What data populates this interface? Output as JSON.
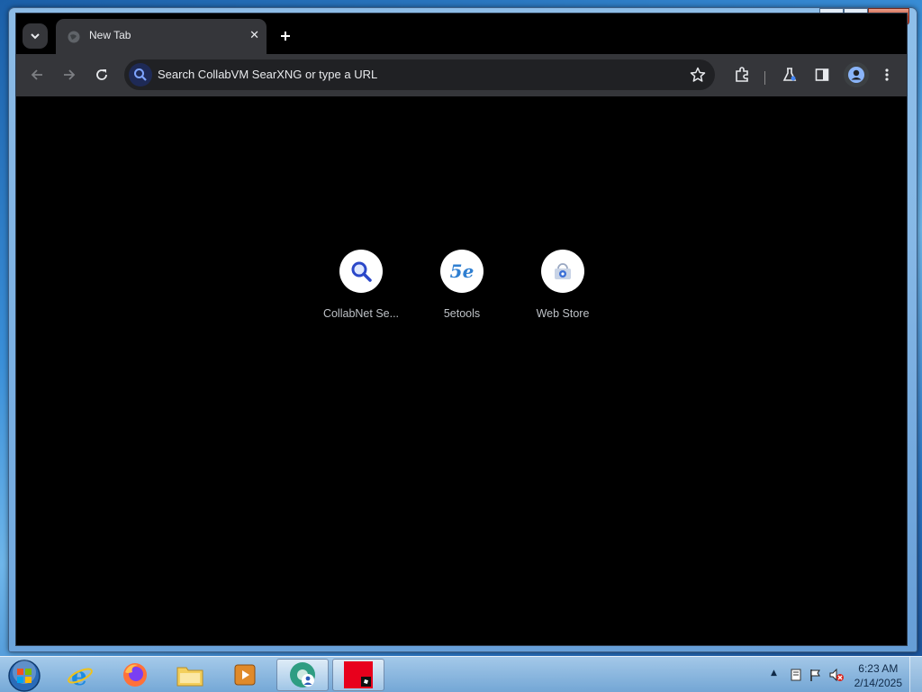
{
  "window": {
    "minimize_glyph": "‒",
    "maximize_glyph": "□",
    "close_glyph": "✕"
  },
  "browser": {
    "tab": {
      "title": "New Tab",
      "close_glyph": "✕"
    },
    "newtab_glyph": "+",
    "omnibox": {
      "placeholder": "Search CollabVM SearXNG or type a URL"
    },
    "toolbar_icons": [
      "back-icon",
      "forward-icon",
      "reload-icon",
      "star-icon",
      "extensions-icon",
      "labs-icon",
      "side-panel-icon",
      "profile-icon",
      "more-icon"
    ]
  },
  "ntp": {
    "shortcuts": [
      {
        "label": "CollabNet Se...",
        "icon": "search-magnifier"
      },
      {
        "label": "5etools",
        "icon": "5etools-logo",
        "glyph": "5e"
      },
      {
        "label": "Web Store",
        "icon": "web-store-logo"
      }
    ]
  },
  "taskbar": {
    "apps": [
      "internet-explorer",
      "firefox",
      "file-explorer",
      "media-player",
      "chrome",
      "roblox"
    ],
    "active_app": "chrome",
    "clock": {
      "time": "6:23 AM",
      "date": "2/14/2025"
    },
    "tray_arrow": "▲"
  },
  "colors": {
    "toolbar": "#35363a",
    "omnibox": "#202124",
    "page_bg": "#000000",
    "accent_blue": "#4285f4"
  }
}
